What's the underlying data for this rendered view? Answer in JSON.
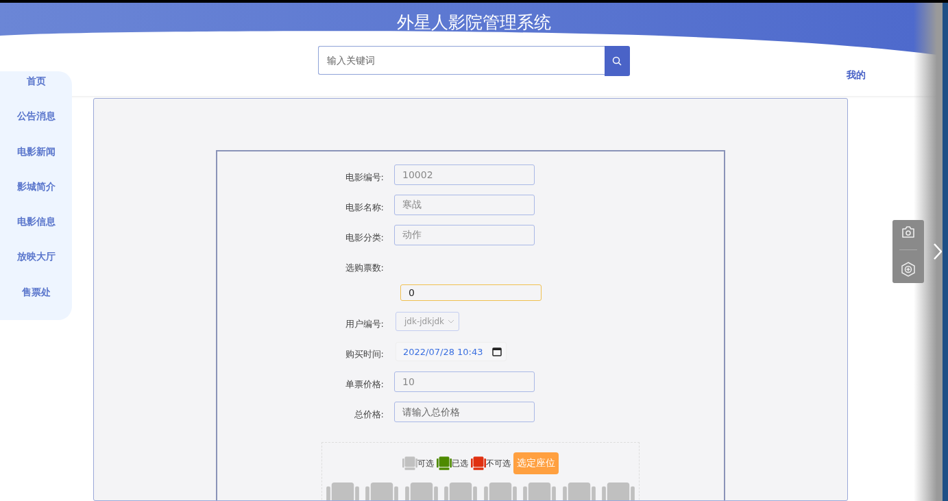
{
  "header": {
    "title": "外星人影院管理系统",
    "search": {
      "placeholder": "输入关键词"
    },
    "user_menu": "我的"
  },
  "sidebar": {
    "items": [
      {
        "label": "首页",
        "selected": false
      },
      {
        "label": "公告消息",
        "selected": false
      },
      {
        "label": "电影新闻",
        "selected": false
      },
      {
        "label": "影城简介",
        "selected": false
      },
      {
        "label": "电影信息",
        "selected": false
      },
      {
        "label": "放映大厅",
        "selected": false
      },
      {
        "label": "售票处",
        "selected": false
      }
    ]
  },
  "form": {
    "fields": [
      {
        "kind": "readonly",
        "label": "电影编号:",
        "value": "10002"
      },
      {
        "kind": "readonly",
        "label": "电影名称:",
        "value": "寒战"
      },
      {
        "kind": "readonly",
        "label": "电影分类:",
        "value": "动作"
      },
      {
        "kind": "focused",
        "label": "选购票数:",
        "value": "0"
      },
      {
        "kind": "select",
        "label": "用户编号:",
        "value": "jdk-jdkjdk"
      },
      {
        "kind": "datetime",
        "label": "购买时间:",
        "value": "2022/07/28 10:43"
      },
      {
        "kind": "readonly",
        "label": "单票价格:",
        "value": "10"
      },
      {
        "kind": "input",
        "label": "总价格:",
        "placeholder": "请输入总价格"
      }
    ]
  },
  "seat_picker": {
    "legend": [
      {
        "label": "可选",
        "color": "#c0c0c0"
      },
      {
        "label": "已选",
        "color": "#4e8a00"
      },
      {
        "label": "不可选",
        "color": "#e03010"
      }
    ],
    "confirm_button": "选定座位",
    "seats": [
      {
        "selected": false
      },
      {
        "selected": false
      },
      {
        "selected": false
      },
      {
        "selected": false
      },
      {
        "selected": false
      },
      {
        "selected": false
      },
      {
        "selected": false
      },
      {
        "selected": false
      }
    ]
  }
}
